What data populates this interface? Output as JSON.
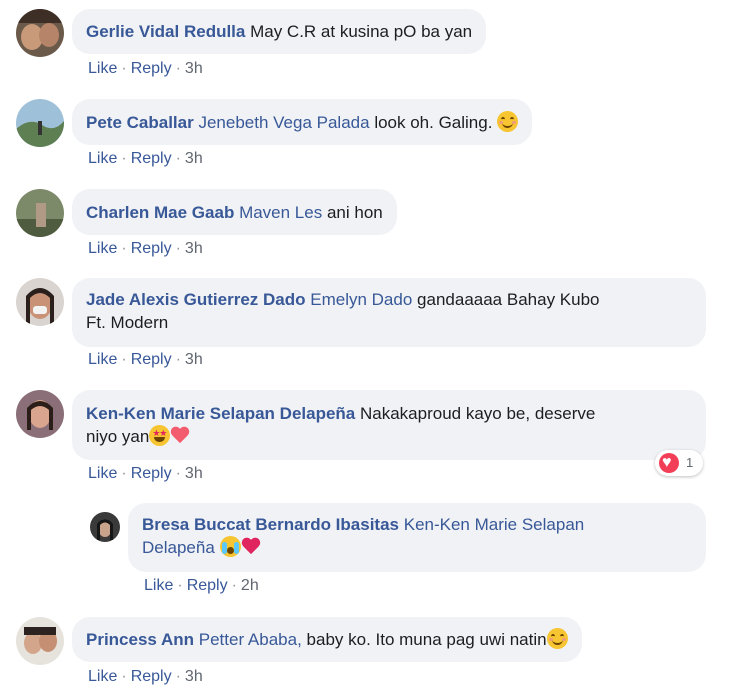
{
  "actions": {
    "like": "Like",
    "reply": "Reply",
    "sep": "·"
  },
  "comments": [
    {
      "author": "Gerlie Vidal Redulla",
      "tag": "",
      "text": "May C.R at kusina pO ba yan",
      "time": "3h"
    },
    {
      "author": "Pete Caballar",
      "tag": "Jenebeth Vega Palada",
      "text": "look oh. Galing.",
      "emoji": "smiling-face",
      "time": "3h"
    },
    {
      "author": "Charlen Mae Gaab",
      "tag": "Maven Les",
      "text": "ani hon",
      "time": "3h"
    },
    {
      "author": "Jade Alexis Gutierrez Dado",
      "tag": "Emelyn Dado",
      "text": "gandaaaaa Bahay Kubo",
      "text2": "Ft. Modern",
      "time": "3h"
    },
    {
      "author": "Ken-Ken Marie Selapan Delapeña",
      "tag": "",
      "text": "Nakakaproud kayo be, deserve",
      "text2": "niyo yan",
      "emoji": "star-struck, mending-heart",
      "time": "3h",
      "reactions": {
        "type": "love",
        "count": "1"
      }
    },
    {
      "author": "Bresa Buccat Bernardo Ibasitas",
      "tag": "Ken-Ken Marie Selapan",
      "tag2": "Delapeña",
      "text": "",
      "emoji": "crying-face, red-heart",
      "time": "2h"
    },
    {
      "author": "Princess Ann",
      "tag": "Petter Ababa,",
      "text": "baby ko. Ito muna pag uwi natin",
      "emoji": "smiling-face",
      "time": "3h"
    }
  ],
  "colors": {
    "name": "#385898",
    "bubble": "#f0f2f5",
    "meta": "#616770"
  }
}
